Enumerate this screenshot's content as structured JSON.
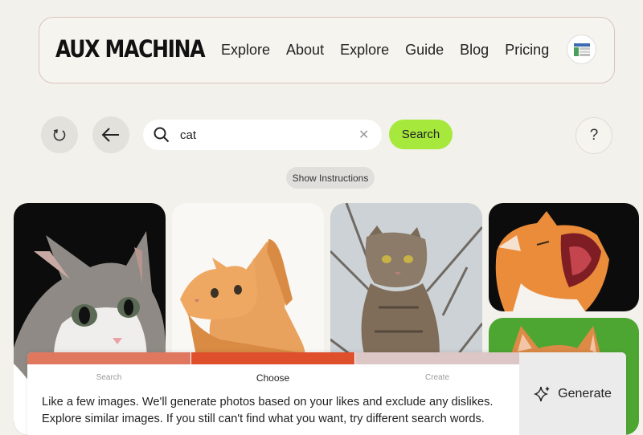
{
  "brand": {
    "logo": "AUX MACHINA"
  },
  "nav": {
    "items": [
      {
        "label": "Explore"
      },
      {
        "label": "About"
      },
      {
        "label": "Explore"
      },
      {
        "label": "Guide"
      },
      {
        "label": "Blog"
      },
      {
        "label": "Pricing"
      }
    ]
  },
  "toolbar": {
    "reset_icon": "reset-icon",
    "back_icon": "arrow-left-icon",
    "search": {
      "value": "cat",
      "clear_icon": "close-icon"
    },
    "search_button": "Search",
    "help_button": "?",
    "instructions_button": "Show Instructions"
  },
  "images": [
    {
      "subject": "grey and white cat close-up on black background"
    },
    {
      "subject": "orange tabby cat crouching on white background"
    },
    {
      "subject": "tabby cat sitting outdoors with branches"
    },
    {
      "subject": "orange cat yawning on black background"
    },
    {
      "subject": "orange cat on green background"
    }
  ],
  "workflow": {
    "steps": [
      {
        "label": "Search",
        "color": "#e07860",
        "active": false
      },
      {
        "label": "Choose",
        "color": "#df4f2c",
        "active": true
      },
      {
        "label": "Create",
        "color": "#dcc7c6",
        "active": false
      }
    ],
    "instructions_line1": "Like a few images. We'll generate photos based on your likes and exclude any dislikes.",
    "instructions_line2": "Explore similar images. If you still can't find what you want, try different search words.",
    "generate_label": "Generate",
    "generate_icon": "sparkle-icon"
  },
  "colors": {
    "accent": "#a6e83c",
    "background": "#f3f1ec"
  }
}
